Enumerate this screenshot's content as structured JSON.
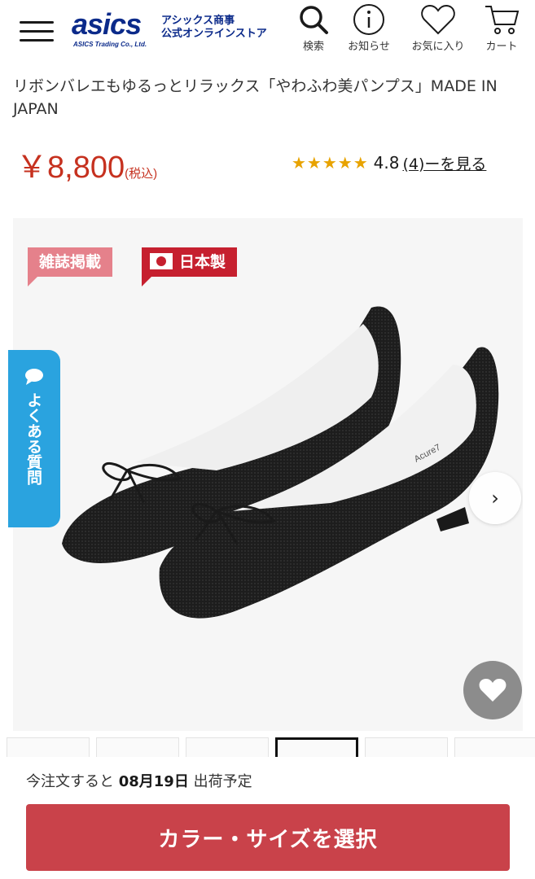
{
  "header": {
    "logo_text": "asics",
    "logo_sub": "ASICS Trading Co., Ltd.",
    "store_name_line1": "アシックス商事",
    "store_name_line2": "公式オンラインストア",
    "nav": [
      {
        "label": "検索",
        "icon": "search-icon"
      },
      {
        "label": "お知らせ",
        "icon": "info-icon"
      },
      {
        "label": "お気に入り",
        "icon": "heart-icon"
      },
      {
        "label": "カート",
        "icon": "cart-icon"
      }
    ]
  },
  "product": {
    "title": "リボンバレエもゆるっとリラックス「やわふわ美パンプス」MADE IN JAPAN",
    "price": "￥8,800",
    "price_tax": "(税込)",
    "stars": "★★★★★",
    "rating": "4.8",
    "reviews_link": "(4)ーを見る"
  },
  "gallery": {
    "badges": [
      "雑誌掲載",
      "日本製"
    ],
    "next_arrow": "›",
    "insole_brand": "Acure7"
  },
  "faq_tab": {
    "label": "よくある質問"
  },
  "bottom": {
    "ship_prefix": "今注文すると",
    "ship_date": "08月19日",
    "ship_suffix": "出荷予定",
    "select_button": "カラー・サイズを選択"
  },
  "colors": {
    "price_red": "#c6311f",
    "button_red": "#c9424a",
    "faq_blue": "#2aa3df",
    "logo_navy": "#0b2a8a",
    "star_gold": "#e8a300"
  }
}
